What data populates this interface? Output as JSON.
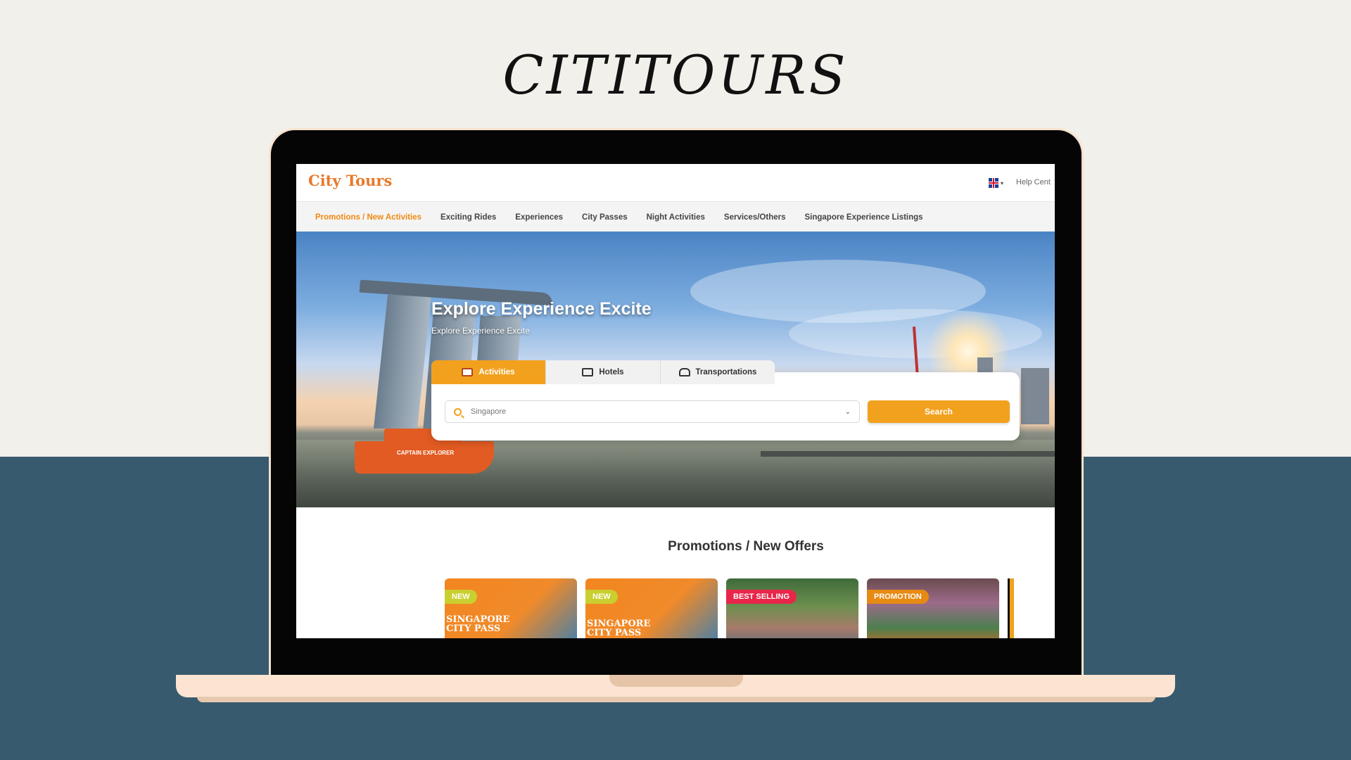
{
  "brand": {
    "title": "CITITOURS"
  },
  "site": {
    "logo": "City Tours",
    "help_label": "Help Cent",
    "nav": [
      "Promotions / New Activities",
      "Exciting Rides",
      "Experiences",
      "City Passes",
      "Night Activities",
      "Services/Others",
      "Singapore Experience Listings"
    ]
  },
  "hero": {
    "title": "Explore Experience Excite",
    "subtitle": "Explore Experience Excite",
    "boat_label": "CAPTAIN EXPLORER"
  },
  "search": {
    "tabs": [
      "Activities",
      "Hotels",
      "Transportations"
    ],
    "active_tab": "Activities",
    "placeholder": "Singapore",
    "button_label": "Search"
  },
  "promotions": {
    "title": "Promotions / New Offers",
    "cards": [
      {
        "badge": "NEW",
        "text_line1": "SINGAPORE",
        "text_line2": "CITY PASS"
      },
      {
        "badge": "NEW",
        "text_line1": "SINGAPORE",
        "text_line2": "CITY PASS"
      },
      {
        "badge": "BEST SELLING"
      },
      {
        "badge": "PROMOTION"
      }
    ]
  },
  "colors": {
    "accent": "#f2a11e",
    "brand_orange": "#e8792b",
    "page_bg": "#f2f0eb",
    "band": "#385a6e"
  }
}
